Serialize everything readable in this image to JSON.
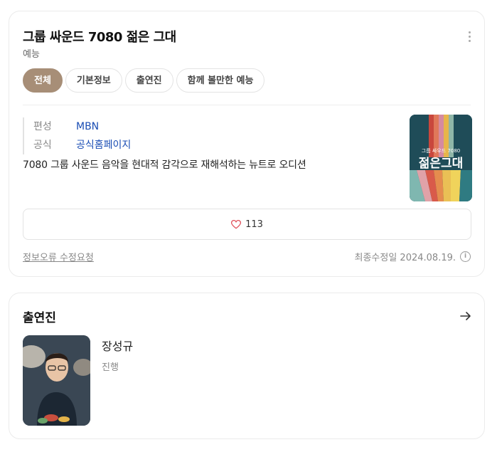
{
  "show": {
    "title": "그룹 싸운드 7080 젊은 그대",
    "genre": "예능"
  },
  "tabs": [
    {
      "label": "전체",
      "active": true
    },
    {
      "label": "기본정보",
      "active": false
    },
    {
      "label": "출연진",
      "active": false
    },
    {
      "label": "함께 볼만한 예능",
      "active": false
    }
  ],
  "meta": {
    "broadcaster_key": "편성",
    "broadcaster_value": "MBN",
    "official_key": "공식",
    "official_value": "공식홈페이지"
  },
  "description": "7080 그룹 사운드 음악을 현대적 감각으로 재해석하는 뉴트로 오디션",
  "poster": {
    "small_text": "그룹 싸우드 7080",
    "big_text": "젊은그대"
  },
  "likes": {
    "count": "113",
    "icon": "heart-icon",
    "color": "#e0505a"
  },
  "footer": {
    "report_label": "정보오류 수정요청",
    "updated_label": "최종수정일 2024.08.19."
  },
  "cast_section": {
    "title": "출연진",
    "members": [
      {
        "name": "장성규",
        "role": "진행"
      }
    ]
  },
  "colors": {
    "accent": "#a78e77",
    "link": "#1a4db4"
  }
}
